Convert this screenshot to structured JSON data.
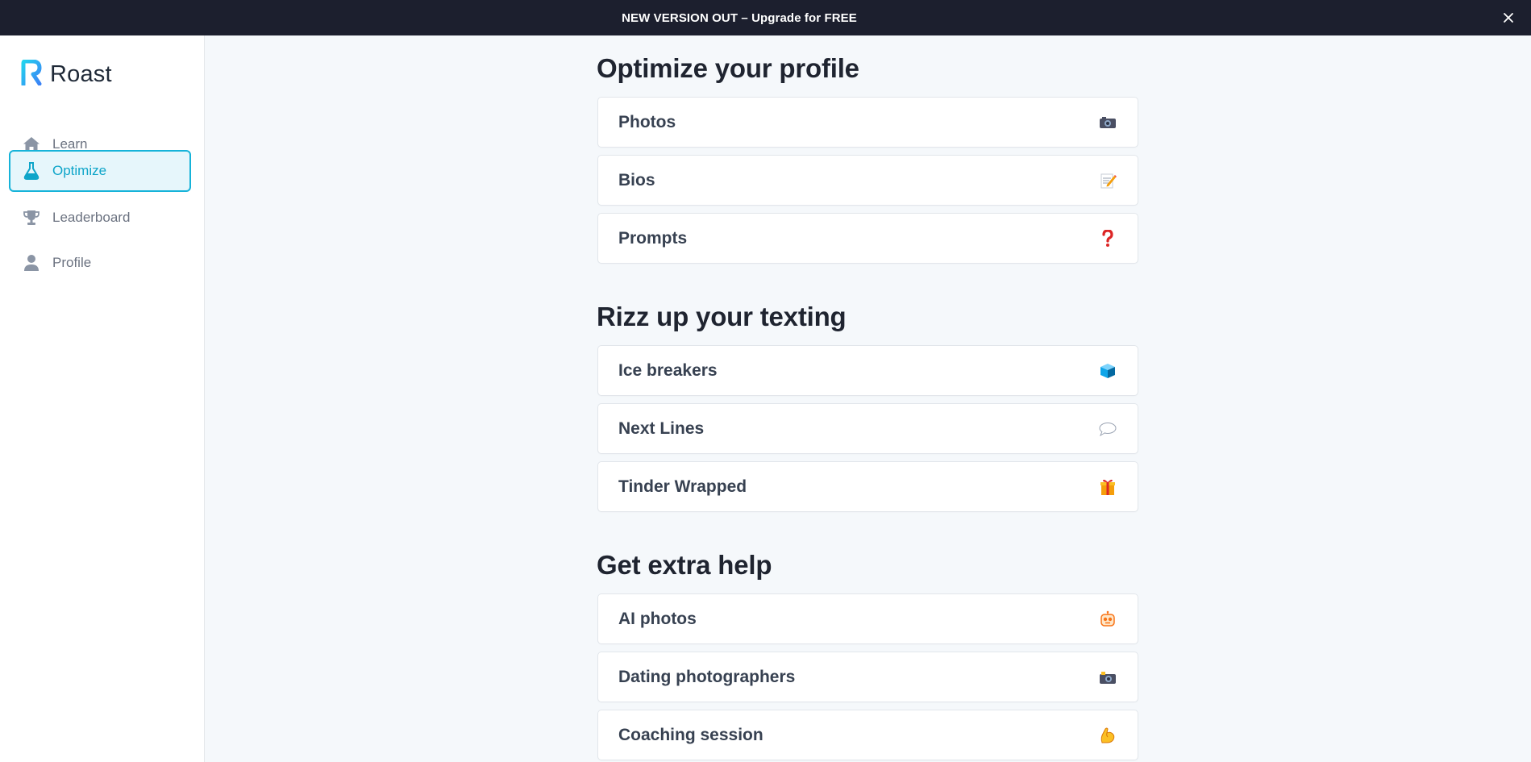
{
  "banner": {
    "text": "NEW VERSION OUT – Upgrade for FREE"
  },
  "app": {
    "name": "Roast"
  },
  "sidebar": {
    "items": [
      {
        "label": "Learn",
        "icon": "home-icon"
      },
      {
        "label": "Optimize",
        "icon": "flask-icon",
        "active": true
      },
      {
        "label": "Leaderboard",
        "icon": "trophy-icon"
      },
      {
        "label": "Profile",
        "icon": "person-icon"
      }
    ]
  },
  "sections": [
    {
      "title": "Optimize your profile",
      "cards": [
        {
          "label": "Photos",
          "icon": "camera-icon"
        },
        {
          "label": "Bios",
          "icon": "memo-icon"
        },
        {
          "label": "Prompts",
          "icon": "question-mark-icon"
        }
      ]
    },
    {
      "title": "Rizz up your texting",
      "cards": [
        {
          "label": "Ice breakers",
          "icon": "ice-cube-icon"
        },
        {
          "label": "Next Lines",
          "icon": "speech-bubble-icon"
        },
        {
          "label": "Tinder Wrapped",
          "icon": "gift-icon"
        }
      ]
    },
    {
      "title": "Get extra help",
      "cards": [
        {
          "label": "AI photos",
          "icon": "robot-icon"
        },
        {
          "label": "Dating photographers",
          "icon": "camera-flash-icon"
        },
        {
          "label": "Coaching session",
          "icon": "flexed-biceps-icon"
        }
      ]
    }
  ],
  "colors": {
    "accent": "#16b3d9",
    "banner_bg": "#1c1f2e",
    "page_bg": "#f5f8fb"
  }
}
